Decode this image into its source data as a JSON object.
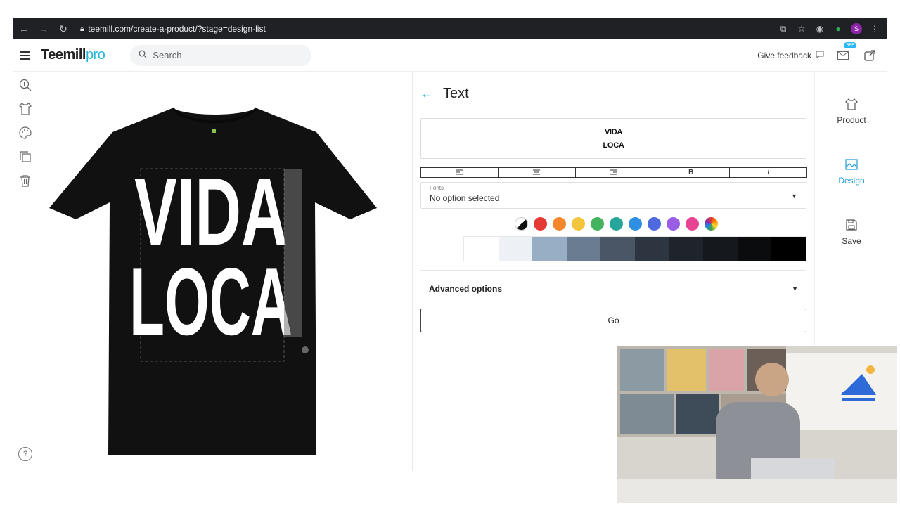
{
  "browser": {
    "url": "teemill.com/create-a-product/?stage=design-list",
    "profile_initial": "S"
  },
  "header": {
    "logo_main": "Teemill",
    "logo_suffix": "pro",
    "search_placeholder": "Search",
    "feedback_label": "Give feedback",
    "mail_badge": "988"
  },
  "canvas": {
    "shirt_color": "#111111",
    "text_lines": [
      "VIDA",
      "LOCA"
    ]
  },
  "panel": {
    "title": "Text",
    "text_value_line1": "VIDA",
    "text_value_line2": "LOCA",
    "format_buttons": [
      {
        "icon": "align-left-icon",
        "glyph": "≡"
      },
      {
        "icon": "align-center-icon",
        "glyph": "≡"
      },
      {
        "icon": "align-right-icon",
        "glyph": "≡"
      },
      {
        "icon": "bold-icon",
        "glyph": "B"
      },
      {
        "icon": "italic-icon",
        "glyph": "I"
      }
    ],
    "fonts_label": "Fonts",
    "fonts_value": "No option selected",
    "swatch_colors": [
      "#e53935",
      "#f4862b",
      "#f2c53d",
      "#43b35f",
      "#26a69a",
      "#2f8fe0",
      "#4f6ae0",
      "#9a5ee6",
      "#e84393"
    ],
    "shade_colors": [
      "#ffffff",
      "#edf0f4",
      "#98aec4",
      "#697c92",
      "#4a5566",
      "#2d3540",
      "#1f242c",
      "#15181d",
      "#0b0c0e",
      "#000000"
    ],
    "advanced_label": "Advanced options",
    "go_label": "Go"
  },
  "rightnav": {
    "product": "Product",
    "design": "Design",
    "save": "Save",
    "accent": "#1e9ad6"
  }
}
